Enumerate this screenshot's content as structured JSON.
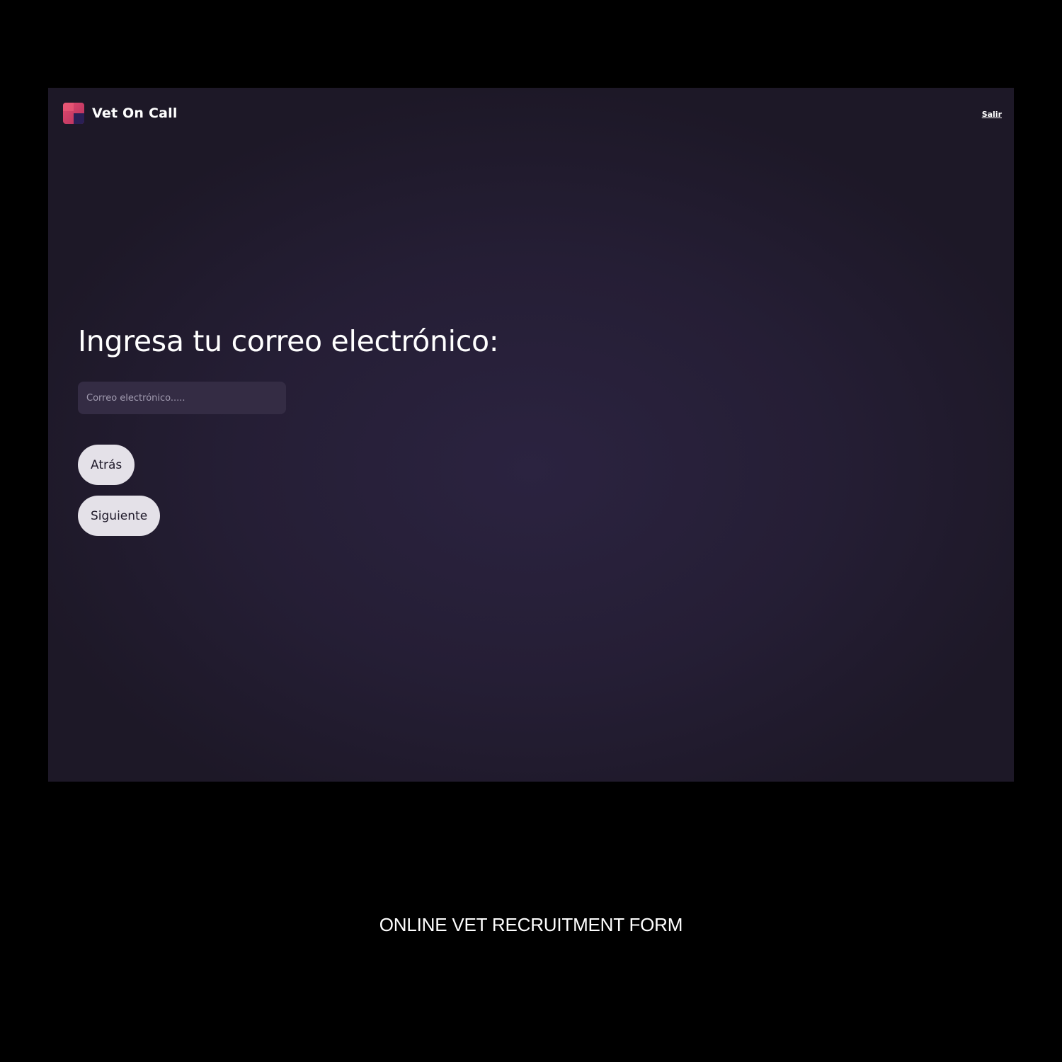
{
  "app": {
    "brand_name": "Vet On Call",
    "logo_icon": "vet-on-call-logo-icon"
  },
  "header": {
    "exit_link": "Salir"
  },
  "main": {
    "heading": "Ingresa tu correo electrónico:",
    "email_input": {
      "placeholder": "Correo electrónico.....",
      "value": ""
    },
    "back_button": "Atrás",
    "next_button": "Siguiente"
  },
  "caption": "ONLINE VET RECRUITMENT FORM",
  "colors": {
    "page_background": "#000000",
    "screen_background": "#251e35",
    "input_background": "#342c44",
    "button_background": "#e4e1e8",
    "logo_accent": "#e04b6e",
    "logo_dark": "#2a1f55"
  }
}
